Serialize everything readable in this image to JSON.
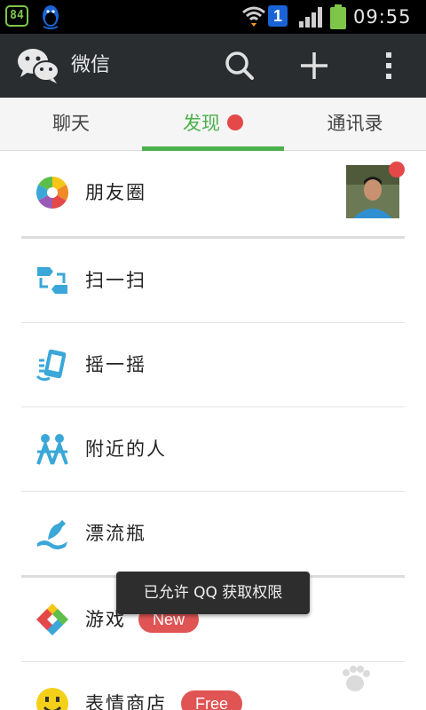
{
  "status_bar": {
    "notification_badge": "84",
    "sim_slot": "1",
    "time": "09:55",
    "battery_color": "#7ec64a",
    "icons": [
      "qq-penguin-icon",
      "wifi-icon",
      "signal-icon",
      "battery-icon"
    ]
  },
  "header": {
    "title": "微信",
    "icons": [
      "wechat-logo-icon",
      "search-icon",
      "plus-icon",
      "more-vertical-icon"
    ]
  },
  "tabs": [
    {
      "label": "聊天",
      "active": false
    },
    {
      "label": "发现",
      "active": true,
      "has_dot": true
    },
    {
      "label": "通讯录",
      "active": false
    }
  ],
  "items": [
    {
      "label": "朋友圈",
      "icon": "moments-aperture-icon",
      "has_thumbnail": true,
      "has_dot": true
    },
    {
      "label": "扫一扫",
      "icon": "scan-icon"
    },
    {
      "label": "摇一摇",
      "icon": "shake-phone-icon"
    },
    {
      "label": "附近的人",
      "icon": "people-nearby-icon"
    },
    {
      "label": "漂流瓶",
      "icon": "drift-bottle-icon"
    },
    {
      "label": "游戏",
      "icon": "games-icon",
      "badge": "New"
    },
    {
      "label": "表情商店",
      "icon": "sticker-smiley-icon",
      "badge": "Free"
    }
  ],
  "toast": "已允许 QQ 获取权限",
  "colors": {
    "accent": "#4bb14b",
    "header_bg": "#2a2d30",
    "badge_red": "#e05454",
    "icon_blue": "#3aa7d8"
  }
}
